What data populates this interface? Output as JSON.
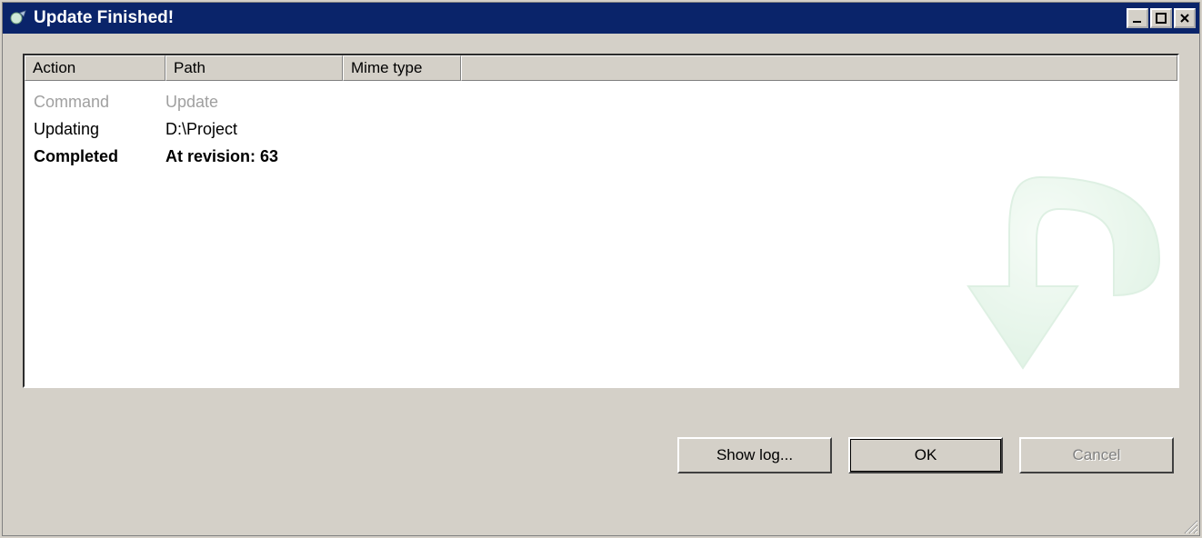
{
  "window": {
    "title": "Update Finished!"
  },
  "columns": {
    "action": "Action",
    "path": "Path",
    "mime": "Mime type"
  },
  "rows": [
    {
      "action": "Command",
      "path": "Update",
      "style": "muted"
    },
    {
      "action": "Updating",
      "path": "D:\\Project",
      "style": ""
    },
    {
      "action": "Completed",
      "path": "At revision: 63",
      "style": "bold"
    }
  ],
  "buttons": {
    "showlog": "Show log...",
    "ok": "OK",
    "cancel": "Cancel"
  }
}
